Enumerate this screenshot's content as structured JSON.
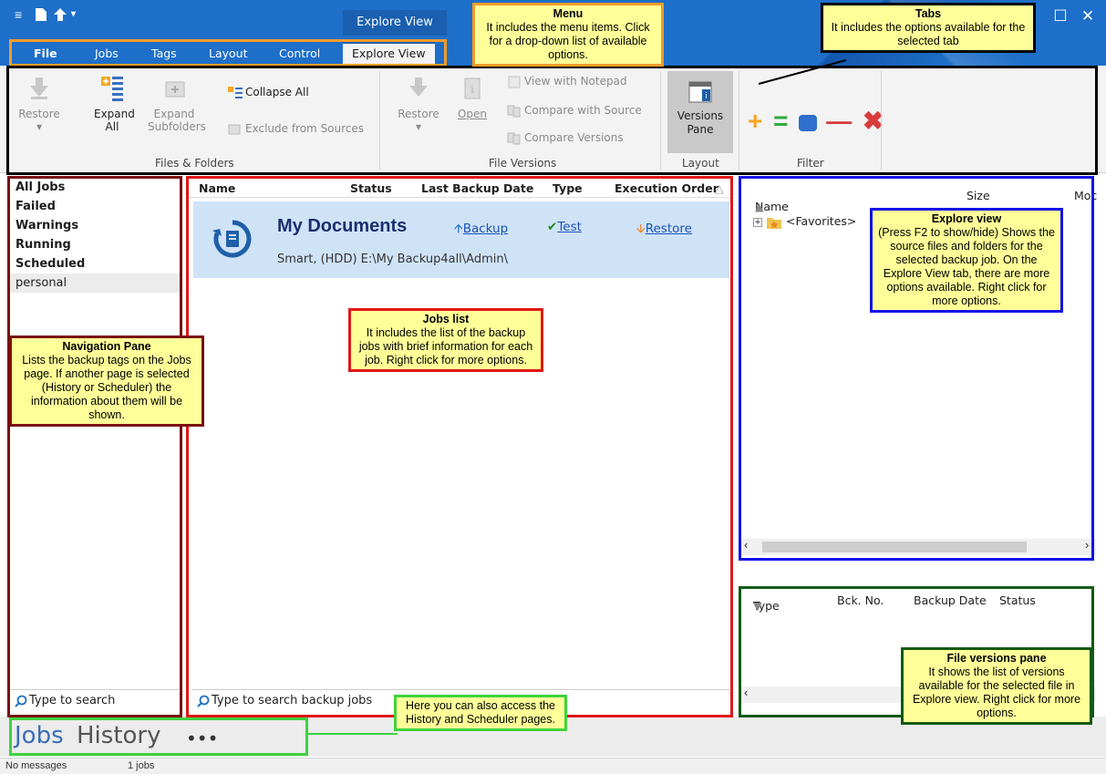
{
  "window": {
    "context_tab": "Explore View",
    "controls": {
      "minimize_icon": "minimize-icon",
      "maximize_icon": "maximize-icon",
      "close_icon": "close-icon"
    }
  },
  "menu": {
    "items": [
      {
        "label": "File"
      },
      {
        "label": "Jobs"
      },
      {
        "label": "Tags"
      },
      {
        "label": "Layout"
      },
      {
        "label": "Control"
      },
      {
        "label": "Explore View"
      }
    ]
  },
  "ribbon": {
    "files_folders": {
      "label": "Files & Folders",
      "restore": "Restore",
      "expand_all": "Expand All",
      "expand_subfolders": "Expand Subfolders",
      "collapse_all": "Collapse All",
      "exclude_from_sources": "Exclude from Sources"
    },
    "file_versions": {
      "label": "File Versions",
      "restore": "Restore",
      "open": "Open",
      "view_with_notepad": "View with Notepad",
      "compare_with_source": "Compare with Source",
      "compare_versions": "Compare Versions"
    },
    "layout": {
      "label": "Layout",
      "versions_pane": "Versions Pane"
    },
    "filter": {
      "label": "Filter"
    }
  },
  "navigation": {
    "items": [
      {
        "label": "All Jobs"
      },
      {
        "label": "Failed"
      },
      {
        "label": "Warnings"
      },
      {
        "label": "Running"
      },
      {
        "label": "Scheduled"
      },
      {
        "label": "personal"
      }
    ],
    "search_placeholder": "Type to search"
  },
  "jobs": {
    "columns": [
      "Name",
      "Status",
      "Last Backup Date",
      "Type",
      "Execution Order"
    ],
    "items": [
      {
        "name": "My Documents",
        "backup": "Backup",
        "test": "Test",
        "restore": "Restore",
        "details": "Smart, (HDD) E:\\My Backup4all\\Admin\\"
      }
    ],
    "search_placeholder": "Type to search backup jobs"
  },
  "explore": {
    "columns": [
      "Name",
      "Size",
      "Moc"
    ],
    "tree": [
      {
        "label": "<Favorites>"
      }
    ]
  },
  "versions": {
    "columns": [
      "Type",
      "Bck. No.",
      "Backup Date",
      "Status"
    ]
  },
  "bottom_tabs": {
    "jobs": "Jobs",
    "history": "History",
    "more": "•••"
  },
  "status": {
    "messages": "No messages",
    "jobs_count": "1 jobs"
  },
  "annotations": {
    "menu": {
      "title": "Menu",
      "body": "It includes the menu items. Click for a drop-down list of available options."
    },
    "tabs": {
      "title": "Tabs",
      "body": "It includes the options available for the selected tab"
    },
    "navigation": {
      "title": "Navigation Pane",
      "body": "Lists the backup tags on the Jobs page. If another page is selected (History or Scheduler) the information about them will be shown."
    },
    "jobs_list": {
      "title": "Jobs list",
      "body": "It includes the list of the backup jobs with brief information for each job. Right click for more options."
    },
    "explore": {
      "title": "Explore view",
      "body": "(Press F2 to show/hide) Shows the source files and folders for the selected backup job. On the Explore View tab, there are more options available. Right click for more options."
    },
    "file_versions": {
      "title": "File versions pane",
      "body": "It shows the list of versions available for the selected file in Explore view. Right click for more options."
    },
    "pages": {
      "body": "Here you can also access the History and Scheduler pages."
    }
  },
  "colors": {
    "titlebar": "#1e6fc9",
    "menu_frame": "#f39c26",
    "tabs_frame": "#000000",
    "nav_frame": "#7a1010",
    "jobs_frame": "#e01818",
    "explore_frame": "#1414e6",
    "versions_frame": "#135a13",
    "pages_frame": "#3fd23f",
    "callout_bg": "#ffff99"
  }
}
